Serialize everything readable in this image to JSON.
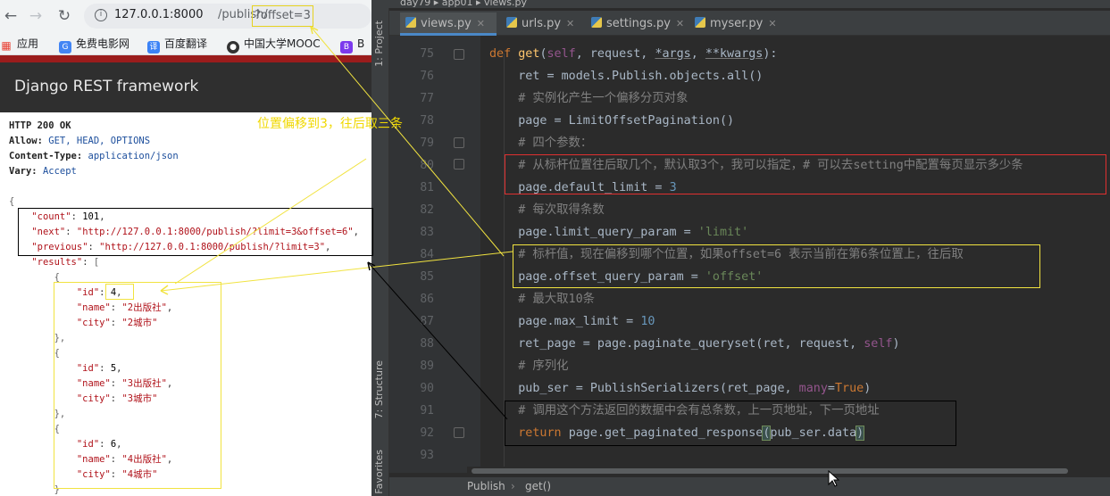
{
  "browser": {
    "url_host": "127.0.0.1:8000",
    "url_path": "/publish/",
    "url_query": "?offset=3",
    "bookmarks": [
      {
        "label": "应用",
        "icon": "apps-grid-icon",
        "color": "#e94235"
      },
      {
        "label": "免费电影网",
        "icon": "g-favicon-icon",
        "color": "#4285f4"
      },
      {
        "label": "百度翻译",
        "icon": "translate-icon",
        "color": "#3b82f6"
      },
      {
        "label": "中国大学MOOC",
        "icon": "globe-icon",
        "color": "#333333"
      },
      {
        "label": "B",
        "icon": "b-favicon-icon",
        "color": "#7c3aed"
      }
    ]
  },
  "drf": {
    "title": "Django REST framework",
    "status_line": "HTTP 200 OK",
    "headers": [
      {
        "key": "Allow:",
        "value": "GET, HEAD, OPTIONS"
      },
      {
        "key": "Content-Type:",
        "value": "application/json"
      },
      {
        "key": "Vary:",
        "value": "Accept"
      }
    ]
  },
  "response": {
    "count_key": "\"count\"",
    "count": "101",
    "next_key": "\"next\"",
    "next": "\"http://127.0.0.1:8000/publish/?limit=3&offset=6\"",
    "previous_key": "\"previous\"",
    "previous": "\"http://127.0.0.1:8000/publish/?limit=3\"",
    "results_key": "\"results\"",
    "results": [
      {
        "id": "4",
        "name": "\"2出版社\"",
        "city": "\"2城市\""
      },
      {
        "id": "5",
        "name": "\"3出版社\"",
        "city": "\"3城市\""
      },
      {
        "id": "6",
        "name": "\"4出版社\"",
        "city": "\"4城市\""
      }
    ]
  },
  "annotation": "位置偏移到3，往后取三条",
  "ide": {
    "project_crumbs": [
      "day79",
      "app01",
      "views.py"
    ],
    "tabs": [
      {
        "label": "views.py",
        "active": true
      },
      {
        "label": "urls.py",
        "active": false
      },
      {
        "label": "settings.py",
        "active": false
      },
      {
        "label": "myser.py",
        "active": false
      }
    ],
    "side_labels": [
      "1: Project",
      "7: Structure",
      "2: Favorites"
    ],
    "line_numbers": [
      "75",
      "76",
      "77",
      "78",
      "79",
      "80",
      "81",
      "82",
      "83",
      "84",
      "85",
      "86",
      "87",
      "88",
      "89",
      "90",
      "91",
      "92",
      "93"
    ],
    "status_crumbs": [
      "Publish",
      "get()"
    ],
    "code": {
      "l75_def": "def ",
      "l75_fn": "get",
      "l75_a": "(",
      "l75_self": "self",
      "l75_b": ", request, ",
      "l75_args": "*args",
      "l75_c": ", ",
      "l75_kwargs": "**kwargs",
      "l75_d": "):",
      "l76": "ret = models.Publish.objects.all()",
      "l77": "# 实例化产生一个偏移分页对象",
      "l78": "page = LimitOffsetPagination()",
      "l79": "# 四个参数：",
      "l80": "# 从标杆位置往后取几个，默认取3个，我可以指定，# 可以去setting中配置每页显示多少条",
      "l81_a": "page.default_limit = ",
      "l81_n": "3",
      "l82": "# 每次取得条数",
      "l83_a": "page.limit_query_param = ",
      "l83_s": "'limit'",
      "l84": "# 标杆值，现在偏移到哪个位置，如果offset=6 表示当前在第6条位置上，往后取",
      "l85_a": "page.offset_query_param = ",
      "l85_s": "'offset'",
      "l86": "# 最大取10条",
      "l87_a": "page.max_limit = ",
      "l87_n": "10",
      "l88_a": "ret_page = page.paginate_queryset(ret, request, ",
      "l88_self": "self",
      "l88_b": ")",
      "l89": "# 序列化",
      "l90_a": "pub_ser = PublishSerializers(ret_page, ",
      "l90_kw": "many",
      "l90_b": "=",
      "l90_true": "True",
      "l90_c": ")",
      "l91": "# 调用这个方法返回的数据中会有总条数，上一页地址，下一页地址",
      "l92_kw": "return ",
      "l92_a": "page.get_paginated_response",
      "l92_p1": "(",
      "l92_b": "pub_ser.data",
      "l92_p2": ")"
    }
  }
}
